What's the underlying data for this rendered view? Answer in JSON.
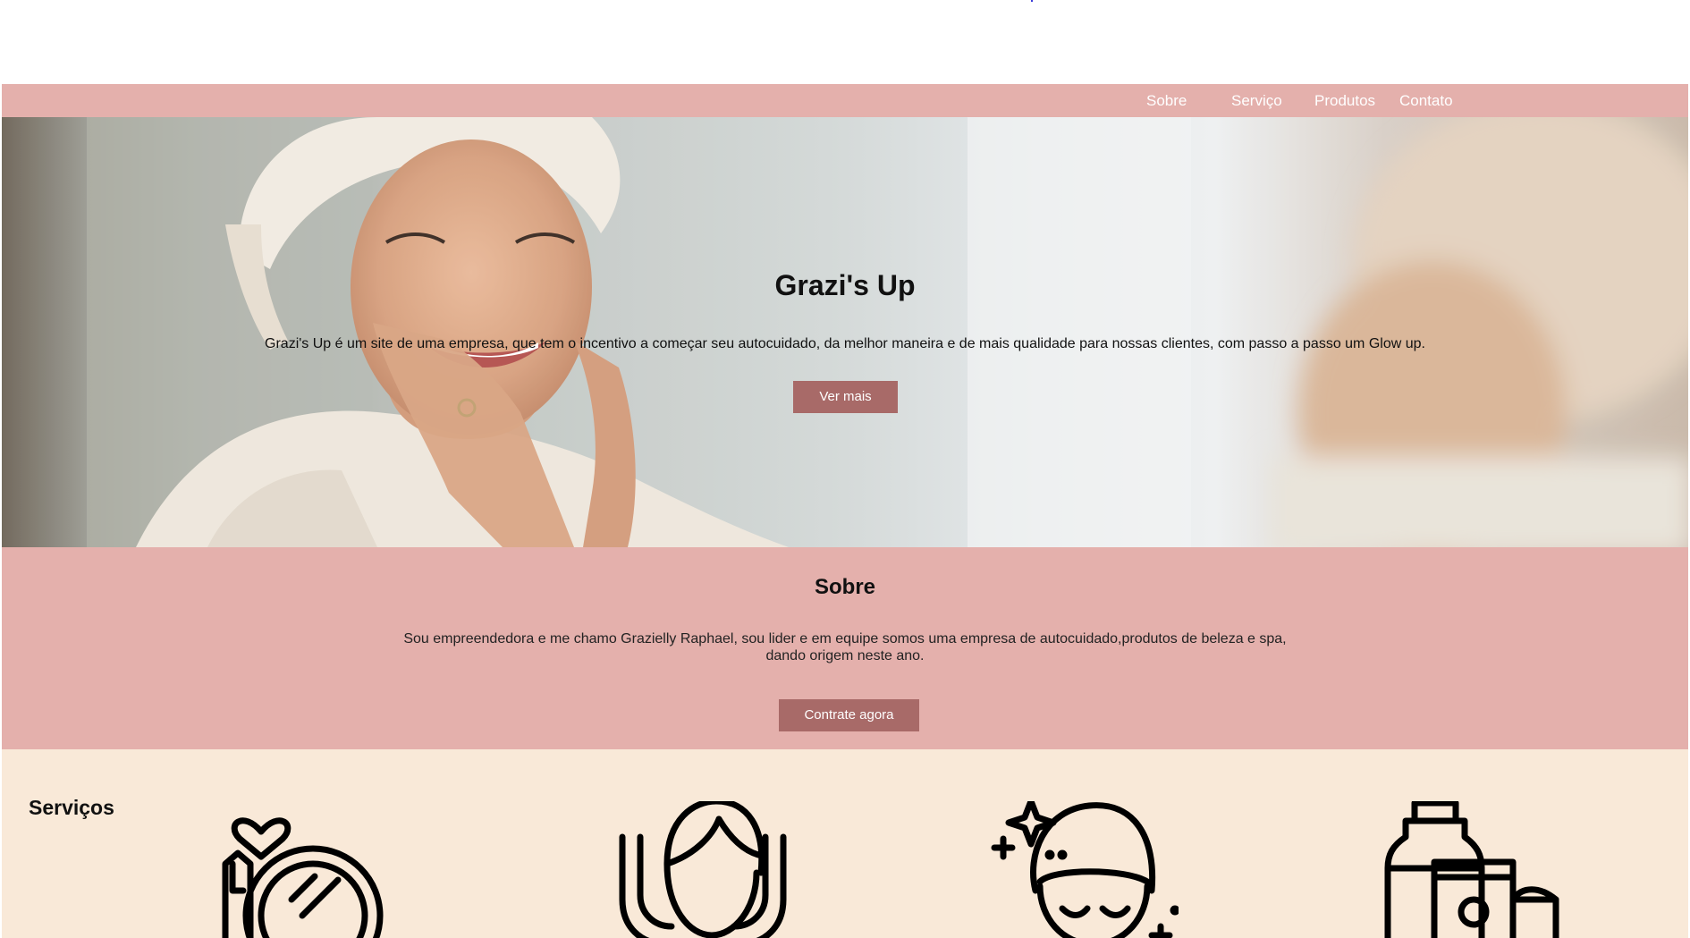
{
  "nav": {
    "items": [
      "Sobre",
      "Serviço",
      "Produtos",
      "Contato"
    ]
  },
  "hero": {
    "title": "Grazi's Up",
    "description": "Grazi's Up é um site de uma empresa, que tem o incentivo a começar seu autocuidado, da melhor maneira e de mais qualidade para nossas clientes, com passo a passo um Glow up.",
    "button_label": "Ver mais"
  },
  "sobre": {
    "title": "Sobre",
    "text": "Sou empreendedora e me chamo Grazielly Raphael, sou lider e em equipe somos uma empresa de autocuidado,produtos de beleza e spa, dando origem neste ano.",
    "button_label": "Contrate agora"
  },
  "servicos": {
    "title": "Serviços",
    "icons": [
      "makeup-mirror-icon",
      "hair-care-icon",
      "facial-spa-icon",
      "skincare-products-icon"
    ]
  },
  "colors": {
    "nav_bg": "#e4b0ac",
    "button_bg": "#a86a68",
    "servicos_bg": "#f9e9d8"
  }
}
